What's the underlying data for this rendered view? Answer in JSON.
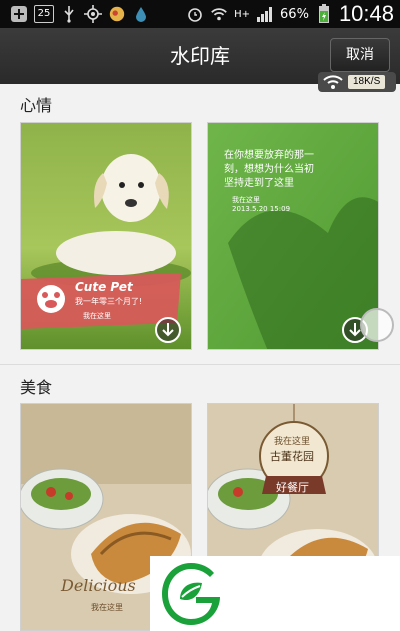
{
  "statusbar": {
    "calendar_day": "25",
    "network": "H+",
    "battery": "66%",
    "time": "10:48"
  },
  "header": {
    "title": "水印库",
    "cancel_label": "取消"
  },
  "net_badge": {
    "speed": "18K/S"
  },
  "sections": [
    {
      "title": "心情",
      "cards": [
        {
          "name": "cute-pet",
          "heading": "Cute Pet",
          "subtitle": "我一年零三个月了!",
          "location": "我在这里"
        },
        {
          "name": "grass-quote",
          "quote_line1": "在你想要放弃的那一",
          "quote_line2": "刻，想想为什么当初",
          "quote_line3": "坚持走到了这里",
          "location": "我在这里",
          "date": "2013.5.20 15:09"
        }
      ]
    },
    {
      "title": "美食",
      "cards": [
        {
          "name": "delicious",
          "heading": "Delicious",
          "location": "我在这里"
        },
        {
          "name": "restaurant",
          "line1": "我在这里",
          "line2": "古董花园",
          "banner": "好餐厅"
        }
      ]
    }
  ],
  "colors": {
    "header_bg": "#2f2f2f",
    "statusbar_bg": "#0c0c0c",
    "page_bg": "#f2f2f2",
    "pet_banner": "#d9585a",
    "logo_green": "#1aa13a"
  }
}
